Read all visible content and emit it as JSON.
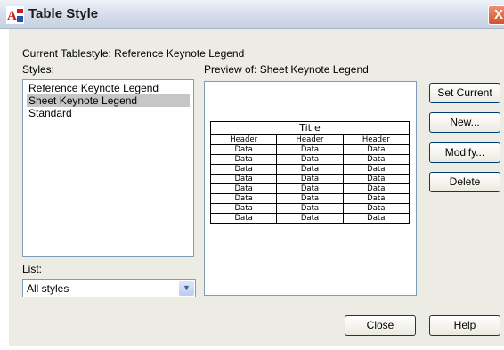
{
  "window": {
    "title": "Table Style",
    "app_icon_text": "A",
    "close_glyph": "X"
  },
  "dialog": {
    "current_label": "Current Tablestyle: Reference Keynote Legend",
    "styles_label": "Styles:",
    "preview_label": "Preview of: Sheet Keynote Legend",
    "styles": [
      {
        "label": "Reference Keynote Legend",
        "selected": false
      },
      {
        "label": "Sheet Keynote Legend",
        "selected": true
      },
      {
        "label": "Standard",
        "selected": false
      }
    ],
    "list_label": "List:",
    "list_value": "All styles",
    "buttons": {
      "set_current": "Set Current",
      "new": "New...",
      "modify": "Modify...",
      "delete": "Delete",
      "close": "Close",
      "help": "Help"
    }
  },
  "preview_table": {
    "title": "Title",
    "headers": [
      "Header",
      "Header",
      "Header"
    ],
    "rows": [
      [
        "Data",
        "Data",
        "Data"
      ],
      [
        "Data",
        "Data",
        "Data"
      ],
      [
        "Data",
        "Data",
        "Data"
      ],
      [
        "Data",
        "Data",
        "Data"
      ],
      [
        "Data",
        "Data",
        "Data"
      ],
      [
        "Data",
        "Data",
        "Data"
      ],
      [
        "Data",
        "Data",
        "Data"
      ],
      [
        "Data",
        "Data",
        "Data"
      ]
    ]
  },
  "colors": {
    "dialog_bg": "#ecebe4",
    "selected_item_bg": "#c6c6c6",
    "close_button_red": "#d4522f"
  }
}
